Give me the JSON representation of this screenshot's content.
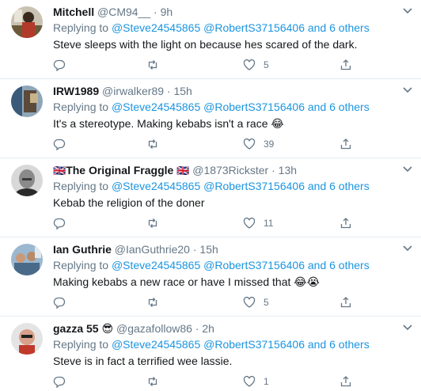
{
  "tweets": [
    {
      "name": "Mitchell",
      "handle": "@CM94__",
      "time": "9h",
      "reply_prefix": "Replying to",
      "reply_mentions": "@Steve24545865 @RobertS37156406 and 6 others",
      "text": "Steve sleeps with the light on because hes scared of the dark.",
      "likes": "5"
    },
    {
      "name": "IRW1989",
      "handle": "@irwalker89",
      "time": "15h",
      "reply_prefix": "Replying to",
      "reply_mentions": "@Steve24545865 @RobertS37156406 and 6 others",
      "text": "It's a stereotype. Making kebabs isn't a race",
      "emoji": "😂",
      "likes": "39"
    },
    {
      "name_flag_left": "🇬🇧",
      "name": "The Original Fraggle",
      "name_flag_right": "🇬🇧",
      "handle": "@1873Rickster",
      "time": "13h",
      "reply_prefix": "Replying to",
      "reply_mentions": "@Steve24545865 @RobertS37156406 and 6 others",
      "text": "Kebab the religion of the doner",
      "likes": "11"
    },
    {
      "name": "Ian Guthrie",
      "handle": "@IanGuthrie20",
      "time": "15h",
      "reply_prefix": "Replying to",
      "reply_mentions": "@Steve24545865 @RobertS37156406 and 6 others",
      "text": "Making kebabs a new race or have I missed that",
      "emoji": "😂😭",
      "likes": "5"
    },
    {
      "name": "gazza 55",
      "name_emoji": "😎",
      "handle": "@gazafollow86",
      "time": "2h",
      "reply_prefix": "Replying to",
      "reply_mentions": "@Steve24545865 @RobertS37156406 and 6 others",
      "text": "Steve is in fact a terrified wee lassie.",
      "likes": "1"
    }
  ],
  "separator": "·",
  "icons": {
    "reply": "reply-icon",
    "retweet": "retweet-icon",
    "like": "like-icon",
    "share": "share-icon",
    "more": "chevron-down-icon"
  },
  "colors": {
    "link": "#1b95e0",
    "secondary": "#657786",
    "text": "#14171a",
    "divider": "#e6ecf0"
  }
}
